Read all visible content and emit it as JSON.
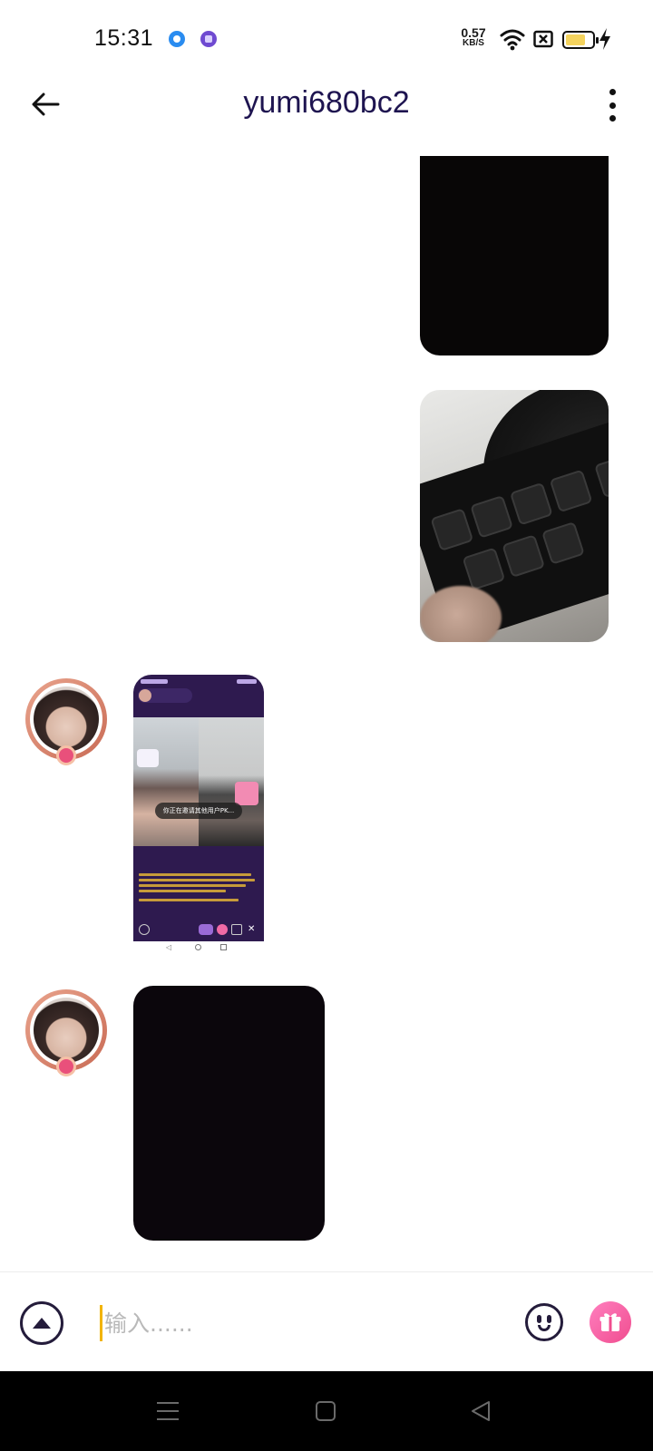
{
  "status_bar": {
    "time": "15:31",
    "net_speed_value": "0.57",
    "net_speed_unit": "KB/S",
    "battery_level": 0.75,
    "battery_color": "#f4d35e",
    "icons": [
      "app-notification-blue",
      "app-notification-purple",
      "wifi",
      "sim-disabled",
      "battery",
      "charging-bolt"
    ]
  },
  "header": {
    "title": "yumi680bc2",
    "title_color": "#1e1450"
  },
  "screenshot_message": {
    "toast": "你正在邀请其他用户PK..."
  },
  "input_bar": {
    "placeholder": "输入......",
    "accent_color": "#f2b400",
    "gift_color": "#f04d8f"
  },
  "nav_bar": {
    "icons": [
      "menu-icon",
      "home-icon",
      "back-triangle-icon"
    ]
  }
}
